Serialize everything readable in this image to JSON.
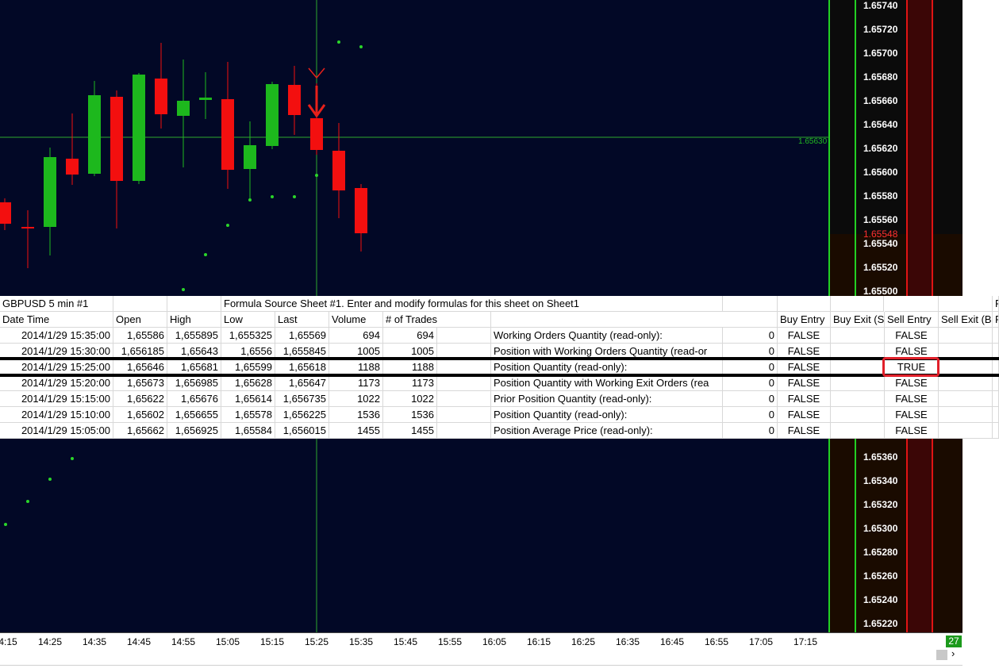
{
  "chart": {
    "symbol_info": "GBPUSD  5 min  #1",
    "crosshair_price": "1.65630",
    "last_price": "1.65548",
    "price_labels_top": [
      "1.65740",
      "1.65720",
      "1.65700",
      "1.65680",
      "1.65660",
      "1.65640",
      "1.65620",
      "1.65600",
      "1.65580",
      "1.65560",
      "1.65540",
      "1.65520",
      "1.65500"
    ],
    "price_labels_bottom": [
      "1.65360",
      "1.65340",
      "1.65320",
      "1.65300",
      "1.65280",
      "1.65260",
      "1.65240",
      "1.65220"
    ],
    "time_labels": [
      "4:15",
      "14:25",
      "14:35",
      "14:45",
      "14:55",
      "15:05",
      "15:15",
      "15:25",
      "15:35",
      "15:45",
      "15:55",
      "16:05",
      "16:15",
      "16:25",
      "16:35",
      "16:45",
      "16:55",
      "17:05",
      "17:15"
    ],
    "badge": "27",
    "colors": {
      "background": "#020826",
      "up": "#1db81d",
      "down": "#f30f0f",
      "crosshair": "#2fa82f"
    }
  },
  "sheet": {
    "title_cell": "GBPUSD  5 min  #1",
    "formula_note": "Formula Source Sheet #1.  Enter and modify formulas for this sheet on Sheet1",
    "corner_text": "P",
    "headers": [
      "Date Time",
      "Open",
      "High",
      "Low",
      "Last",
      "Volume",
      "# of Trades",
      "",
      "Buy Entry",
      "Buy Exit (S",
      "Sell Entry",
      "Sell Exit (B",
      "P"
    ],
    "rows": [
      {
        "dt": "2014/1/29 15:35:00",
        "open": "1,65586",
        "high": "1,655895",
        "low": "1,655325",
        "last": "1,65569",
        "vol": "694",
        "trades": "694",
        "label": "Working Orders Quantity (read-only):",
        "val": "0",
        "buy_entry": "FALSE",
        "sell_entry": "FALSE"
      },
      {
        "dt": "2014/1/29 15:30:00",
        "open": "1,656185",
        "high": "1,65643",
        "low": "1,6556",
        "last": "1,655845",
        "vol": "1005",
        "trades": "1005",
        "label": "Position with Working Orders Quantity (read-or",
        "val": "0",
        "buy_entry": "FALSE",
        "sell_entry": "FALSE"
      },
      {
        "dt": "2014/1/29 15:25:00",
        "open": "1,65646",
        "high": "1,65681",
        "low": "1,65599",
        "last": "1,65618",
        "vol": "1188",
        "trades": "1188",
        "label": "Position Quantity (read-only):",
        "val": "0",
        "buy_entry": "FALSE",
        "sell_entry": "TRUE"
      },
      {
        "dt": "2014/1/29 15:20:00",
        "open": "1,65673",
        "high": "1,656985",
        "low": "1,65628",
        "last": "1,65647",
        "vol": "1173",
        "trades": "1173",
        "label": "Position Quantity with Working Exit Orders (rea",
        "val": "0",
        "buy_entry": "FALSE",
        "sell_entry": "FALSE"
      },
      {
        "dt": "2014/1/29 15:15:00",
        "open": "1,65622",
        "high": "1,65676",
        "low": "1,65614",
        "last": "1,656735",
        "vol": "1022",
        "trades": "1022",
        "label": "Prior Position Quantity (read-only):",
        "val": "0",
        "buy_entry": "FALSE",
        "sell_entry": "FALSE"
      },
      {
        "dt": "2014/1/29 15:10:00",
        "open": "1,65602",
        "high": "1,656655",
        "low": "1,65578",
        "last": "1,656225",
        "vol": "1536",
        "trades": "1536",
        "label": "Position Quantity (read-only):",
        "val": "0",
        "buy_entry": "FALSE",
        "sell_entry": "FALSE"
      },
      {
        "dt": "2014/1/29 15:05:00",
        "open": "1,65662",
        "high": "1,656925",
        "low": "1,65584",
        "last": "1,656015",
        "vol": "1455",
        "trades": "1455",
        "label": "Position Average Price (read-only):",
        "val": "0",
        "buy_entry": "FALSE",
        "sell_entry": "FALSE"
      }
    ]
  }
}
